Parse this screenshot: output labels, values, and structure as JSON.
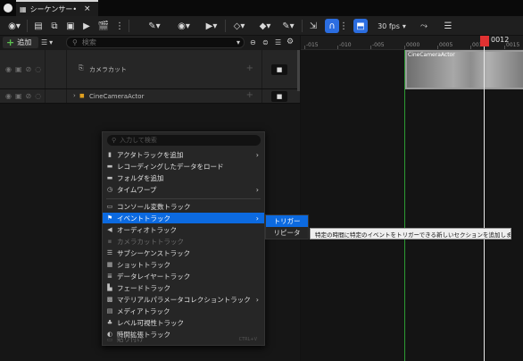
{
  "window": {
    "tab_title": "シーケンサー•",
    "close": "×"
  },
  "toolbar": {
    "fps": "30 fps"
  },
  "tracklist": {
    "add_label": "追加",
    "search_placeholder": "検索",
    "rows": [
      {
        "label": "カメラカット"
      },
      {
        "label": "CineCameraActor"
      }
    ]
  },
  "timeline": {
    "ticks": [
      "-015",
      "-010",
      "-005",
      "0000",
      "0005",
      "0010",
      "0015"
    ],
    "current_frame": "0012",
    "clip_title": "CineCameraActor"
  },
  "context_menu": {
    "search_placeholder": "入力して検索",
    "items": [
      {
        "label": "アクタトラックを追加",
        "icon": "actor-icon",
        "submenu": true,
        "enabled": true
      },
      {
        "label": "レコーディングしたデータをロード",
        "icon": "folder-icon",
        "submenu": false,
        "enabled": true
      },
      {
        "label": "フォルダを追加",
        "icon": "folder-icon",
        "submenu": false,
        "enabled": true
      },
      {
        "label": "タイムワープ",
        "icon": "clock-icon",
        "submenu": true,
        "enabled": true
      },
      {
        "label": "コンソール変数トラック",
        "icon": "console-icon",
        "submenu": false,
        "enabled": true
      },
      {
        "label": "イベントトラック",
        "icon": "flag-icon",
        "submenu": true,
        "enabled": true
      },
      {
        "label": "オーディオトラック",
        "icon": "speaker-icon",
        "submenu": false,
        "enabled": true
      },
      {
        "label": "カメラカットトラック",
        "icon": "camera-icon",
        "submenu": false,
        "enabled": false
      },
      {
        "label": "サブシーケンストラック",
        "icon": "subsequence-icon",
        "submenu": false,
        "enabled": true
      },
      {
        "label": "ショットトラック",
        "icon": "film-icon",
        "submenu": false,
        "enabled": true
      },
      {
        "label": "データレイヤートラック",
        "icon": "layers-icon",
        "submenu": false,
        "enabled": true
      },
      {
        "label": "フェードトラック",
        "icon": "fade-icon",
        "submenu": false,
        "enabled": true
      },
      {
        "label": "マテリアルパラメータコレクショントラック",
        "icon": "material-icon",
        "submenu": true,
        "enabled": true
      },
      {
        "label": "メディアトラック",
        "icon": "media-icon",
        "submenu": false,
        "enabled": true
      },
      {
        "label": "レベル可視性トラック",
        "icon": "level-icon",
        "submenu": false,
        "enabled": true
      },
      {
        "label": "時間拡張トラック",
        "icon": "time-icon",
        "submenu": false,
        "enabled": true
      },
      {
        "label": "貼り付け",
        "icon": "paste-icon",
        "submenu": false,
        "enabled": false,
        "shortcut": "CTRL+V"
      }
    ]
  },
  "submenu": {
    "items": [
      {
        "label": "トリガー"
      },
      {
        "label": "リピータ"
      }
    ]
  },
  "tooltip": {
    "text": "特定の時間に特定のイベントをトリガーできる新しいセクションを追加します"
  },
  "colors": {
    "accent": "#0c6ae0",
    "playhead": "#e03232",
    "add_green": "#5cc050"
  }
}
